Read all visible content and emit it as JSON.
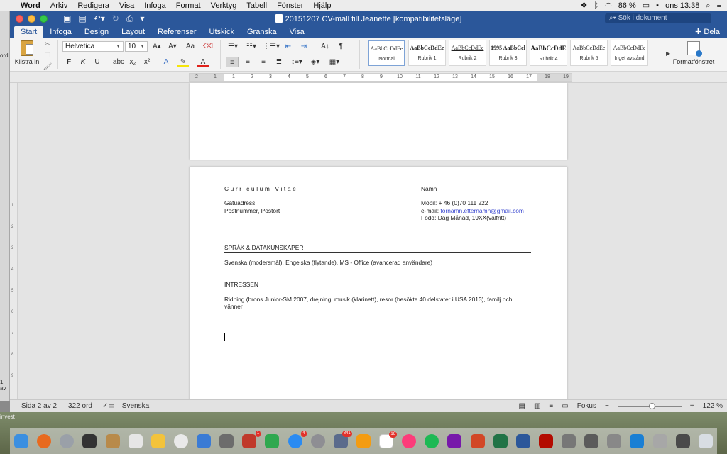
{
  "menubar": {
    "app_name": "Word",
    "items": [
      "Arkiv",
      "Redigera",
      "Visa",
      "Infoga",
      "Format",
      "Verktyg",
      "Tabell",
      "Fönster",
      "Hjälp"
    ],
    "battery": "86 %",
    "clock": "ons 13:38"
  },
  "window": {
    "title": "20151207 CV-mall till Jeanette [kompatibilitetsläge]",
    "search_placeholder": "Sök i dokument"
  },
  "ribbon": {
    "tabs": [
      "Start",
      "Infoga",
      "Design",
      "Layout",
      "Referenser",
      "Utskick",
      "Granska",
      "Visa"
    ],
    "active_tab": "Start",
    "share_label": "Dela",
    "paste_label": "Klistra in",
    "font_name": "Helvetica",
    "font_size": "10",
    "bold": "F",
    "italic": "K",
    "underline": "U",
    "strike": "abc",
    "styles": [
      {
        "preview": "AaBbCcDdEe",
        "name": "Normal"
      },
      {
        "preview": "AaBbCcDdEe",
        "name": "Rubrik 1"
      },
      {
        "preview": "AaBbCcDdEe",
        "name": "Rubrik 2"
      },
      {
        "preview": "1995  AaBbCcl",
        "name": "Rubrik 3"
      },
      {
        "preview": "AaBbCcDdE",
        "name": "Rubrik 4"
      },
      {
        "preview": "AaBbCcDdEe",
        "name": "Rubrik 5"
      },
      {
        "preview": "AaBbCcDdEe",
        "name": "Inget avstånd"
      }
    ],
    "selected_style": "Normal",
    "format_pane_label": "Formatfönstret"
  },
  "ruler": {
    "numbers": [
      "2",
      "1",
      "1",
      "2",
      "3",
      "4",
      "5",
      "6",
      "7",
      "8",
      "9",
      "10",
      "11",
      "12",
      "13",
      "14",
      "15",
      "16",
      "17",
      "18",
      "19"
    ]
  },
  "document": {
    "cv_title": "Curriculum Vitae",
    "name_label": "Namn",
    "street": "Gatuadress",
    "postal": "Postnummer, Postort",
    "mobile": "Mobil: + 46 (0)70 111 222",
    "email_label": "e-mail: ",
    "email": "förnamn.efternamn@gmail.com",
    "born": "Född:  Dag Månad, 19XX(valfritt)",
    "section1_heading": "SPRÅK & DATAKUNSKAPER",
    "section1_text": "Svenska (modersmål), Engelska (flytande), MS - Office (avancerad användare)",
    "section2_heading": "INTRESSEN",
    "section2_text": "Ridning (brons Junior-SM 2007, drejning, musik (klarinett), resor (besökte 40 delstater i USA 2013), familj och vänner"
  },
  "status": {
    "page": "Sida 2 av 2",
    "words": "322 ord",
    "language": "Svenska",
    "focus": "Fokus",
    "zoom": "122 %",
    "zoom_minus": "−",
    "zoom_plus": "+"
  },
  "side_fragments": {
    "left_top": "ord",
    "left_mid": "1 av",
    "desktop_left": "invest"
  },
  "dock": {
    "badges": [
      "1",
      "4",
      "841",
      "16"
    ]
  },
  "colors": {
    "word_blue": "#2b579a",
    "link": "#3b49d0"
  }
}
